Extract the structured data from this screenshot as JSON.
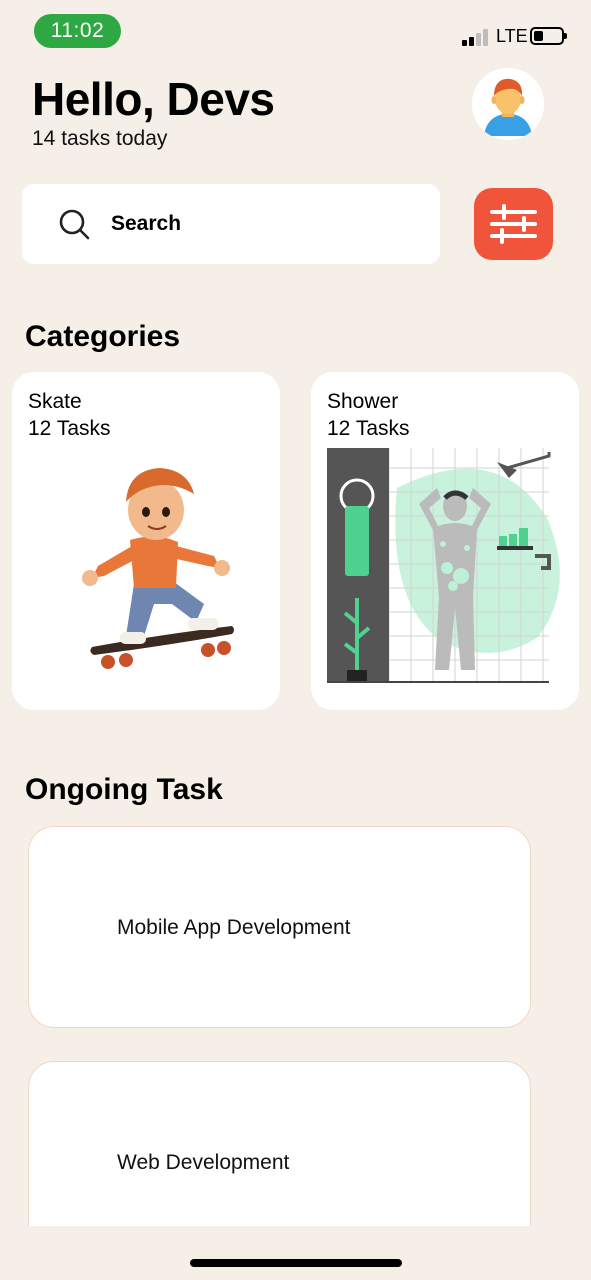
{
  "status": {
    "time": "11:02",
    "network": "LTE"
  },
  "header": {
    "greeting": "Hello, Devs",
    "subtitle": "14 tasks today"
  },
  "search": {
    "placeholder": "Search"
  },
  "categories": {
    "title": "Categories",
    "items": [
      {
        "name": "Skate",
        "count": "12 Tasks"
      },
      {
        "name": "Shower",
        "count": "12 Tasks"
      }
    ]
  },
  "ongoing": {
    "title": "Ongoing Task",
    "items": [
      {
        "label": "Mobile App Development"
      },
      {
        "label": "Web Development"
      }
    ]
  },
  "colors": {
    "accent": "#f0553b",
    "background": "#f5efe8",
    "time_pill": "#2ea843"
  }
}
